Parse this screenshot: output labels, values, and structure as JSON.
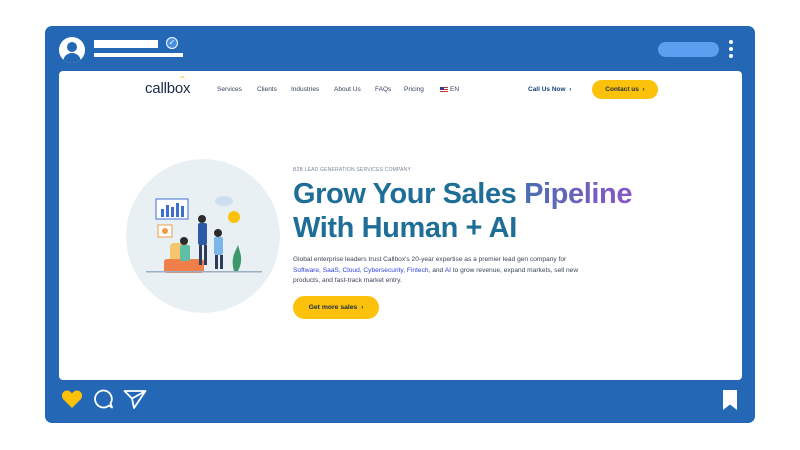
{
  "post": {
    "header_icons": [
      "avatar-icon",
      "verified-badge-icon",
      "more-options-icon"
    ],
    "footer_icons": [
      "heart-icon",
      "comment-icon",
      "send-icon",
      "bookmark-icon"
    ]
  },
  "site": {
    "logo": "callbox",
    "nav": [
      "Services",
      "Clients",
      "Industries",
      "About Us",
      "FAQs",
      "Pricing"
    ],
    "lang": "EN",
    "call_label": "Call Us Now",
    "contact_label": "Contact us",
    "arrow": "›"
  },
  "hero": {
    "eyebrow": "B2B LEAD GENERATION SERVICES COMPANY",
    "title_line1_a": "Grow Your Sales",
    "title_line1_b": "Pipeline",
    "title_line2": "With Human + AI",
    "desc_1": "Global enterprise leaders trust Callbox's 20-year expertise as a premier lead gen company for ",
    "hl_1": "Software",
    "hl_2": "SaaS",
    "hl_3": "Cloud",
    "hl_4": "Cybersecurity",
    "hl_5": "Fintech",
    "hl_6": "AI",
    "desc_2": " to grow revenue, expand markets, sell new products, and fast-track market entry.",
    "cta": "Get more sales"
  },
  "colors": {
    "frame": "#2468b5",
    "accent_yellow": "#fbc10b",
    "title_teal": "#1f6e97",
    "title_purple": "#8a55c6"
  }
}
